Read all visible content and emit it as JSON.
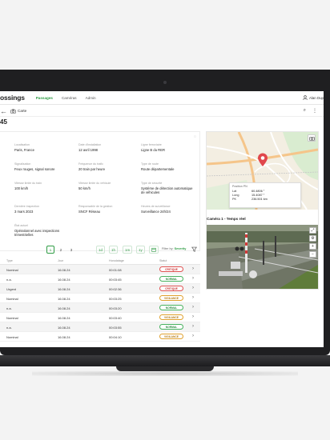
{
  "app": {
    "title": "ossings",
    "nav": [
      "Passages",
      "Caméras",
      "Admin"
    ],
    "user": "Alan Dup"
  },
  "subbar": {
    "back": "←",
    "crumb_label": "Carte",
    "actions": [
      "⌕",
      "⋮"
    ]
  },
  "page": {
    "title": "45"
  },
  "details": {
    "menu": "◌",
    "fields": [
      {
        "label": "Localisation",
        "value": "Paris, France"
      },
      {
        "label": "Date d'installation",
        "value": "12 avril 1998"
      },
      {
        "label": "Ligne ferroviaire",
        "value": "Ligne B du RER"
      },
      {
        "label": "Signalisation",
        "value": "Feux rouges, signal sonore"
      },
      {
        "label": "Fréquence du trafic",
        "value": "20 train par heure"
      },
      {
        "label": "Type de route",
        "value": "Route départementale"
      },
      {
        "label": "Vitesse limite du train",
        "value": "100 km/h"
      },
      {
        "label": "Vitesse limite du véhicule",
        "value": "50 km/h"
      },
      {
        "label": "Type de sécurité",
        "value": "Système de détection automatique de véhicules"
      },
      {
        "label": "Dernière inspection",
        "value": "3 mars 2023"
      },
      {
        "label": "Responsable de la gestion",
        "value": "SNCF Réseau"
      },
      {
        "label": "Heures de surveillance",
        "value": "Surveillance 24h/24"
      },
      {
        "label": "État actuel",
        "value": "Opérationnel avec inspections trimestrielles"
      }
    ]
  },
  "pagination": {
    "pages": [
      "1",
      "2",
      "3"
    ],
    "active": "1",
    "ranges": [
      "1d",
      "1h",
      "1m",
      "1y"
    ],
    "filter_label": "Filter by:",
    "filter_value": "Severity"
  },
  "table": {
    "columns": [
      "Type",
      "Jour",
      "Horodatage",
      "Statut"
    ],
    "rows": [
      {
        "type": "Nominal",
        "day": "16.08.24",
        "time": "00:01:08",
        "status": "CRITIQUE",
        "kind": "crit"
      },
      {
        "type": "n.a.",
        "day": "16.08.24",
        "time": "00:03:45",
        "status": "NORMAL",
        "kind": "norm"
      },
      {
        "type": "Urgent",
        "day": "16.08.24",
        "time": "00:02:36",
        "status": "CRITIQUE",
        "kind": "crit"
      },
      {
        "type": "Nominal",
        "day": "16.08.24",
        "time": "00:03:25",
        "status": "VIGILANCE",
        "kind": "vig"
      },
      {
        "type": "n.a.",
        "day": "16.08.24",
        "time": "00:03:20",
        "status": "NORMAL",
        "kind": "norm"
      },
      {
        "type": "Nominal",
        "day": "16.08.24",
        "time": "00:03:40",
        "status": "VIGILANCE",
        "kind": "vig"
      },
      {
        "type": "n.a.",
        "day": "16.08.24",
        "time": "00:03:55",
        "status": "NORMAL",
        "kind": "norm"
      },
      {
        "type": "Nominal",
        "day": "16.08.24",
        "time": "00:04:10",
        "status": "VIGILANCE",
        "kind": "vig"
      }
    ],
    "chevron": "›"
  },
  "map": {
    "tooltip_title": "Position PN",
    "rows": [
      {
        "k": "Lat",
        "v": "60.4806 °"
      },
      {
        "k": "Long",
        "v": "15.4087 °"
      },
      {
        "k": "PK",
        "v": "236.501 km"
      }
    ],
    "button_icon": "camera-icon"
  },
  "camera": {
    "label": "Caméra 1 - Temps réel",
    "tools": [
      "⤢",
      "⚙",
      "+",
      "−"
    ]
  },
  "colors": {
    "accent": "#2e9c44",
    "critical": "#e05252",
    "normal": "#47b25e",
    "vigilance": "#e0a12e"
  }
}
